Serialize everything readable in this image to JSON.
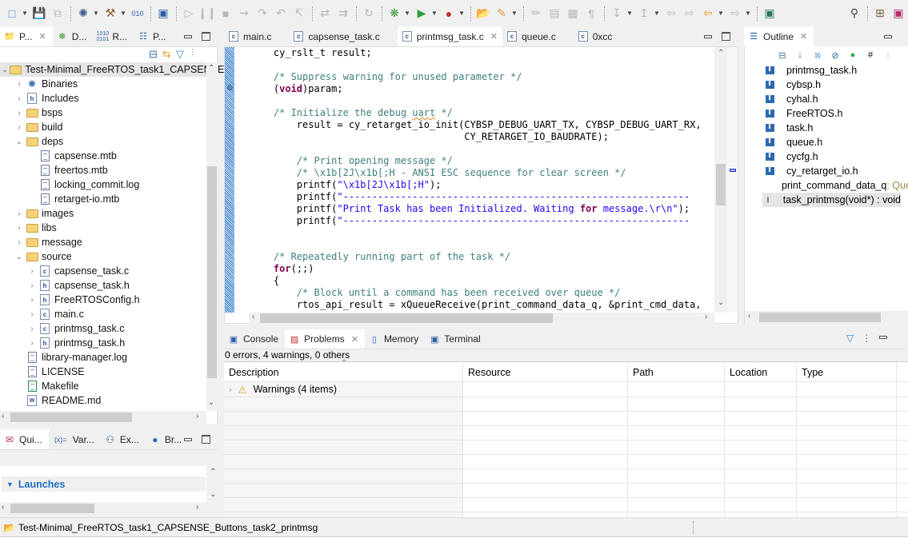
{
  "toolbar": {
    "buttons": [
      "new-icon",
      "save-icon",
      "save-all-icon",
      "debug-config-icon",
      "build-icon",
      "binary-icon",
      "console-icon",
      "resume-icon",
      "suspend-icon",
      "terminate-icon",
      "disconnect-icon",
      "step-into-icon",
      "step-over-icon",
      "step-return-icon",
      "use-step-filters-icon",
      "drop-to-frame-icon",
      "instruction-step-icon",
      "debug-icon",
      "run-icon",
      "external-tools-icon",
      "open-type-icon",
      "open-task-icon",
      "edit-icon",
      "toggle-mark-icon",
      "block-select-icon",
      "whitespace-icon",
      "next-annotation-icon",
      "prev-annotation-icon",
      "last-edit-icon",
      "back-icon",
      "forward-icon",
      "pin-editor-icon",
      "search-icon",
      "open-perspective-icon"
    ]
  },
  "explorer": {
    "tabs": [
      {
        "label": "P...",
        "icon": "project-explorer-icon",
        "active": true
      },
      {
        "label": "D...",
        "icon": "debug-icon"
      },
      {
        "label": "R...",
        "icon": "registers-icon"
      },
      {
        "label": "P...",
        "icon": "peripherals-icon"
      }
    ],
    "tree": [
      {
        "label": "Test-Minimal_FreeRTOS_task1_CAPSENSE_",
        "level": 0,
        "expanded": true,
        "icon": "project",
        "selected": true
      },
      {
        "label": "Binaries",
        "level": 1,
        "expanded": false,
        "icon": "binaries"
      },
      {
        "label": "Includes",
        "level": 1,
        "expanded": false,
        "icon": "includes"
      },
      {
        "label": "bsps",
        "level": 1,
        "expanded": false,
        "icon": "folder"
      },
      {
        "label": "build",
        "level": 1,
        "expanded": false,
        "icon": "folder"
      },
      {
        "label": "deps",
        "level": 1,
        "expanded": true,
        "icon": "folder"
      },
      {
        "label": "capsense.mtb",
        "level": 2,
        "icon": "file"
      },
      {
        "label": "freertos.mtb",
        "level": 2,
        "icon": "file"
      },
      {
        "label": "locking_commit.log",
        "level": 2,
        "icon": "file"
      },
      {
        "label": "retarget-io.mtb",
        "level": 2,
        "icon": "file"
      },
      {
        "label": "images",
        "level": 1,
        "expanded": false,
        "icon": "folder"
      },
      {
        "label": "libs",
        "level": 1,
        "expanded": false,
        "icon": "folder"
      },
      {
        "label": "message",
        "level": 1,
        "expanded": false,
        "icon": "folder"
      },
      {
        "label": "source",
        "level": 1,
        "expanded": true,
        "icon": "folder"
      },
      {
        "label": "capsense_task.c",
        "level": 2,
        "expanded": false,
        "icon": "c"
      },
      {
        "label": "capsense_task.h",
        "level": 2,
        "expanded": false,
        "icon": "h"
      },
      {
        "label": "FreeRTOSConfig.h",
        "level": 2,
        "expanded": false,
        "icon": "h"
      },
      {
        "label": "main.c",
        "level": 2,
        "expanded": false,
        "icon": "c"
      },
      {
        "label": "printmsg_task.c",
        "level": 2,
        "expanded": false,
        "icon": "c"
      },
      {
        "label": "printmsg_task.h",
        "level": 2,
        "expanded": false,
        "icon": "h"
      },
      {
        "label": "library-manager.log",
        "level": 1,
        "icon": "file"
      },
      {
        "label": "LICENSE",
        "level": 1,
        "icon": "file"
      },
      {
        "label": "Makefile",
        "level": 1,
        "icon": "makefile"
      },
      {
        "label": "README.md",
        "level": 1,
        "icon": "word"
      }
    ]
  },
  "editor": {
    "tabs": [
      {
        "label": "main.c",
        "active": false
      },
      {
        "label": "capsense_task.c",
        "active": false
      },
      {
        "label": "printmsg_task.c",
        "active": true
      },
      {
        "label": "queue.c",
        "active": false
      },
      {
        "label": "0xcc",
        "active": false
      }
    ],
    "lines": [
      "    cy_rslt_t result;",
      "",
      "    /* Suppress warning for unused parameter */",
      "    (void)param;",
      "",
      "    /* Initialize the debug uart */",
      "        result = cy_retarget_io_init(CYBSP_DEBUG_UART_TX, CYBSP_DEBUG_UART_RX,",
      "                                     CY_RETARGET_IO_BAUDRATE);",
      "",
      "        /* Print opening message */",
      "        /* \\x1b[2J\\x1b[;H - ANSI ESC sequence for clear screen */",
      "        printf(\"\\x1b[2J\\x1b[;H\");",
      "        printf(\"------------------------------------------------------------",
      "        printf(\"Print Task has been Initialized. Waiting for message.\\r\\n\");",
      "        printf(\"------------------------------------------------------------",
      "",
      "",
      "    /* Repeatedly running part of the task */",
      "    for(;;)",
      "    {",
      "        /* Block until a command has been received over queue */",
      "        rtos_api_result = xQueueReceive(print_command_data_q, &print_cmd_data,"
    ]
  },
  "outline": {
    "title": "Outline",
    "items": [
      {
        "label": "printmsg_task.h",
        "type": "include"
      },
      {
        "label": "cybsp.h",
        "type": "include"
      },
      {
        "label": "cyhal.h",
        "type": "include"
      },
      {
        "label": "FreeRTOS.h",
        "type": "include"
      },
      {
        "label": "task.h",
        "type": "include"
      },
      {
        "label": "queue.h",
        "type": "include"
      },
      {
        "label": "cycfg.h",
        "type": "include"
      },
      {
        "label": "cy_retarget_io.h",
        "type": "include"
      },
      {
        "label": "print_command_data_q",
        "suffix": " : Que",
        "type": "variable"
      },
      {
        "label": "task_printmsg(void*) : void",
        "type": "function",
        "selected": true
      }
    ]
  },
  "bottom": {
    "tabs": [
      {
        "label": "Console",
        "active": false
      },
      {
        "label": "Problems",
        "active": true
      },
      {
        "label": "Memory",
        "active": false
      },
      {
        "label": "Terminal",
        "active": false
      }
    ],
    "summary": "0 errors, 4 warnings, 0 others",
    "columns": [
      "Description",
      "Resource",
      "Path",
      "Location",
      "Type"
    ],
    "rows": [
      {
        "description": "Warnings (4 items)"
      }
    ]
  },
  "quick": {
    "tabs": [
      {
        "label": "Qui...",
        "active": true
      },
      {
        "label": "Var...",
        "active": false
      },
      {
        "label": "Ex...",
        "active": false
      },
      {
        "label": "Br...",
        "active": false
      }
    ],
    "section": "Launches"
  },
  "status": {
    "project": "Test-Minimal_FreeRTOS_task1_CAPSENSE_Buttons_task2_printmsg"
  },
  "colors": {
    "comment": "#3f7f7f",
    "keyword": "#7f0055",
    "string": "#2a00ff",
    "launches": "#1f6fc5"
  }
}
